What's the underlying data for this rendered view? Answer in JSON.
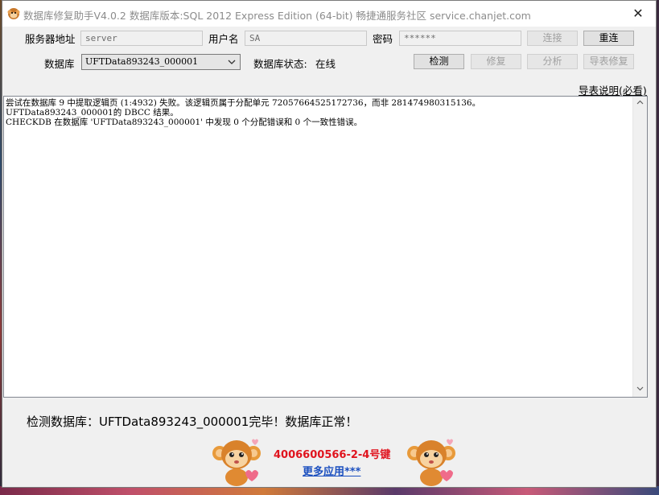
{
  "window": {
    "title": "数据库修复助手V4.0.2 数据库版本:SQL 2012 Express Edition (64-bit)   畅捷通服务社区 service.chanjet.com",
    "close_glyph": "✕"
  },
  "connection": {
    "server_label": "服务器地址",
    "server_value": "server",
    "user_label": "用户名",
    "user_value": "SA",
    "password_label": "密码",
    "password_value": "******",
    "connect_button": "连接",
    "reconnect_button": "重连"
  },
  "database": {
    "label": "数据库",
    "selected": "UFTData893243_000001",
    "status_label": "数据库状态:",
    "status_value": "在线",
    "check_button": "检测",
    "repair_button": "修复",
    "analyze_button": "分析",
    "export_repair_button": "导表修复"
  },
  "help_link": "导表说明(必看)",
  "log": {
    "lines": [
      "尝试在数据库 9 中提取逻辑页 (1:4932) 失败。该逻辑页属于分配单元 72057664525172736，而非 281474980315136。",
      "UFTData893243_000001的 DBCC 结果。",
      "CHECKDB 在数据库 'UFTData893243_000001' 中发现 0 个分配错误和 0 个一致性错误。"
    ]
  },
  "result_message": "检测数据库：UFTData893243_000001完毕！数据库正常！",
  "footer": {
    "phone": "4006600566-2-4号键",
    "more_apps": "更多应用***"
  },
  "icons": {
    "app": "monkey-app-icon",
    "close": "close-icon",
    "dropdown": "chevron-down-icon",
    "scroll_up": "scroll-up-arrow-icon",
    "scroll_down": "scroll-down-arrow-icon",
    "mascot": "monkey-mascot-icon"
  },
  "colors": {
    "phone": "#e0141e",
    "link": "#1b4fbf",
    "window_bg": "#f0f0f0"
  }
}
